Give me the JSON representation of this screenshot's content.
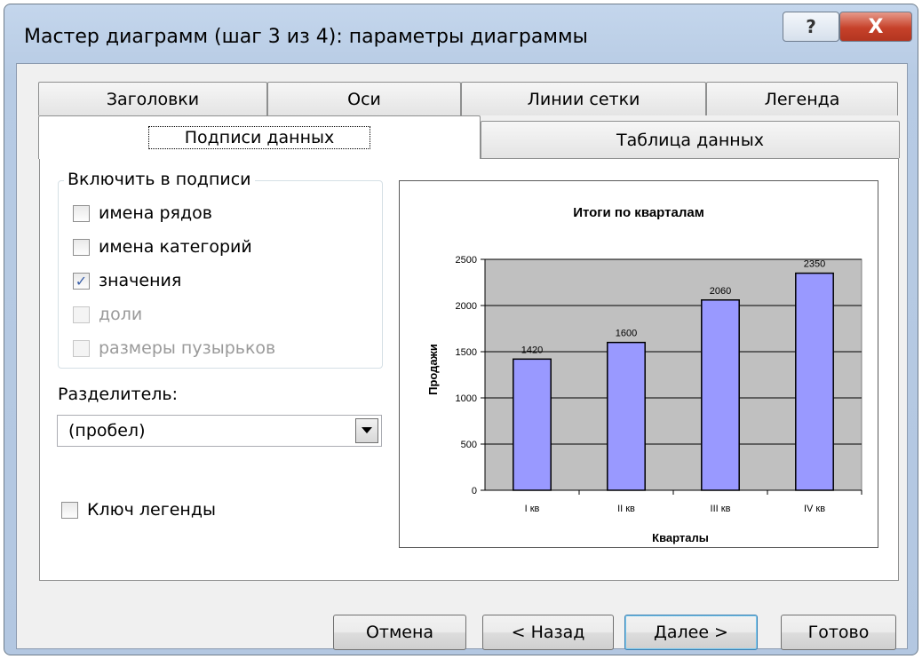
{
  "window": {
    "title": "Мастер диаграмм (шаг 3 из 4): параметры диаграммы",
    "help_glyph": "?",
    "close_glyph": "X"
  },
  "tabs": {
    "row1": [
      "Заголовки",
      "Оси",
      "Линии сетки",
      "Легенда"
    ],
    "row2": [
      "Подписи данных",
      "Таблица данных"
    ],
    "selected": "Подписи данных"
  },
  "labels_group": {
    "title": "Включить в подписи",
    "options": [
      {
        "label": "имена рядов",
        "checked": false,
        "enabled": true
      },
      {
        "label": "имена категорий",
        "checked": false,
        "enabled": true
      },
      {
        "label": "значения",
        "checked": true,
        "enabled": true
      },
      {
        "label": "доли",
        "checked": false,
        "enabled": false
      },
      {
        "label": "размеры пузырьков",
        "checked": false,
        "enabled": false
      }
    ]
  },
  "separator": {
    "label": "Разделитель:",
    "value": "(пробел)"
  },
  "legend_key": {
    "label": "Ключ легенды",
    "checked": false
  },
  "chart_data": {
    "type": "bar",
    "title": "Итоги по кварталам",
    "xlabel": "Кварталы",
    "ylabel": "Продажи",
    "categories": [
      "I кв",
      "II кв",
      "III кв",
      "IV кв"
    ],
    "values": [
      1420,
      1600,
      2060,
      2350
    ],
    "ylim": [
      0,
      2500
    ],
    "yticks": [
      0,
      500,
      1000,
      1500,
      2000,
      2500
    ],
    "data_labels": [
      "1420",
      "1600",
      "2060",
      "2350"
    ],
    "grid": true,
    "colors": {
      "bar": "#9999ff",
      "plot_bg": "#c0c0c0"
    }
  },
  "buttons": {
    "cancel": "Отмена",
    "back": "< Назад",
    "next": "Далее >",
    "finish": "Готово"
  }
}
